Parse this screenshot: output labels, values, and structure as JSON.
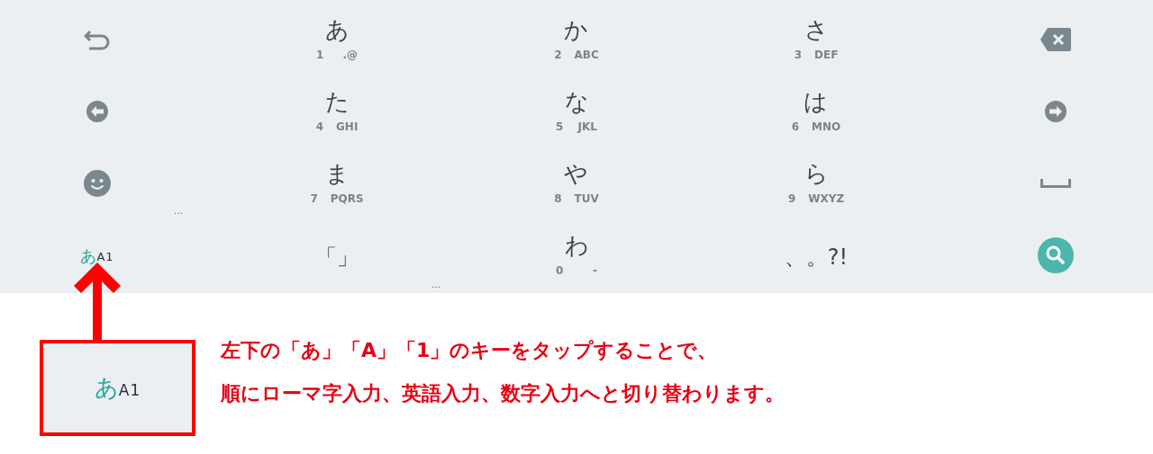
{
  "keyboard": {
    "rows": [
      [
        {
          "kind": "undo"
        },
        {
          "kind": "kana",
          "label": "あ",
          "digit": "1",
          "letters": ".@"
        },
        {
          "kind": "kana",
          "label": "か",
          "digit": "2",
          "letters": "ABC"
        },
        {
          "kind": "kana",
          "label": "さ",
          "digit": "3",
          "letters": "DEF"
        },
        {
          "kind": "backspace"
        }
      ],
      [
        {
          "kind": "left"
        },
        {
          "kind": "kana",
          "label": "た",
          "digit": "4",
          "letters": "GHI"
        },
        {
          "kind": "kana",
          "label": "な",
          "digit": "5",
          "letters": "JKL"
        },
        {
          "kind": "kana",
          "label": "は",
          "digit": "6",
          "letters": "MNO"
        },
        {
          "kind": "right"
        }
      ],
      [
        {
          "kind": "emoji",
          "hint": "…"
        },
        {
          "kind": "kana",
          "label": "ま",
          "digit": "7",
          "letters": "PQRS"
        },
        {
          "kind": "kana",
          "label": "や",
          "digit": "8",
          "letters": "TUV"
        },
        {
          "kind": "kana",
          "label": "ら",
          "digit": "9",
          "letters": "WXYZ"
        },
        {
          "kind": "space"
        }
      ],
      [
        {
          "kind": "mode",
          "primary": "あ",
          "secondary": "A1"
        },
        {
          "kind": "symbol",
          "label": "「」",
          "hint": "…"
        },
        {
          "kind": "kana",
          "label": "わ",
          "digit": "0",
          "letters": "-"
        },
        {
          "kind": "symbol",
          "label": "、。?!"
        },
        {
          "kind": "search"
        }
      ]
    ]
  },
  "annotation": {
    "highlighted_key": {
      "primary": "あ",
      "secondary": "A1"
    },
    "lines": [
      "左下の「あ」「A」「1」のキーをタップすることで、",
      "順にローマ字入力、英語入力、数字入力へと切り替わります。"
    ]
  }
}
